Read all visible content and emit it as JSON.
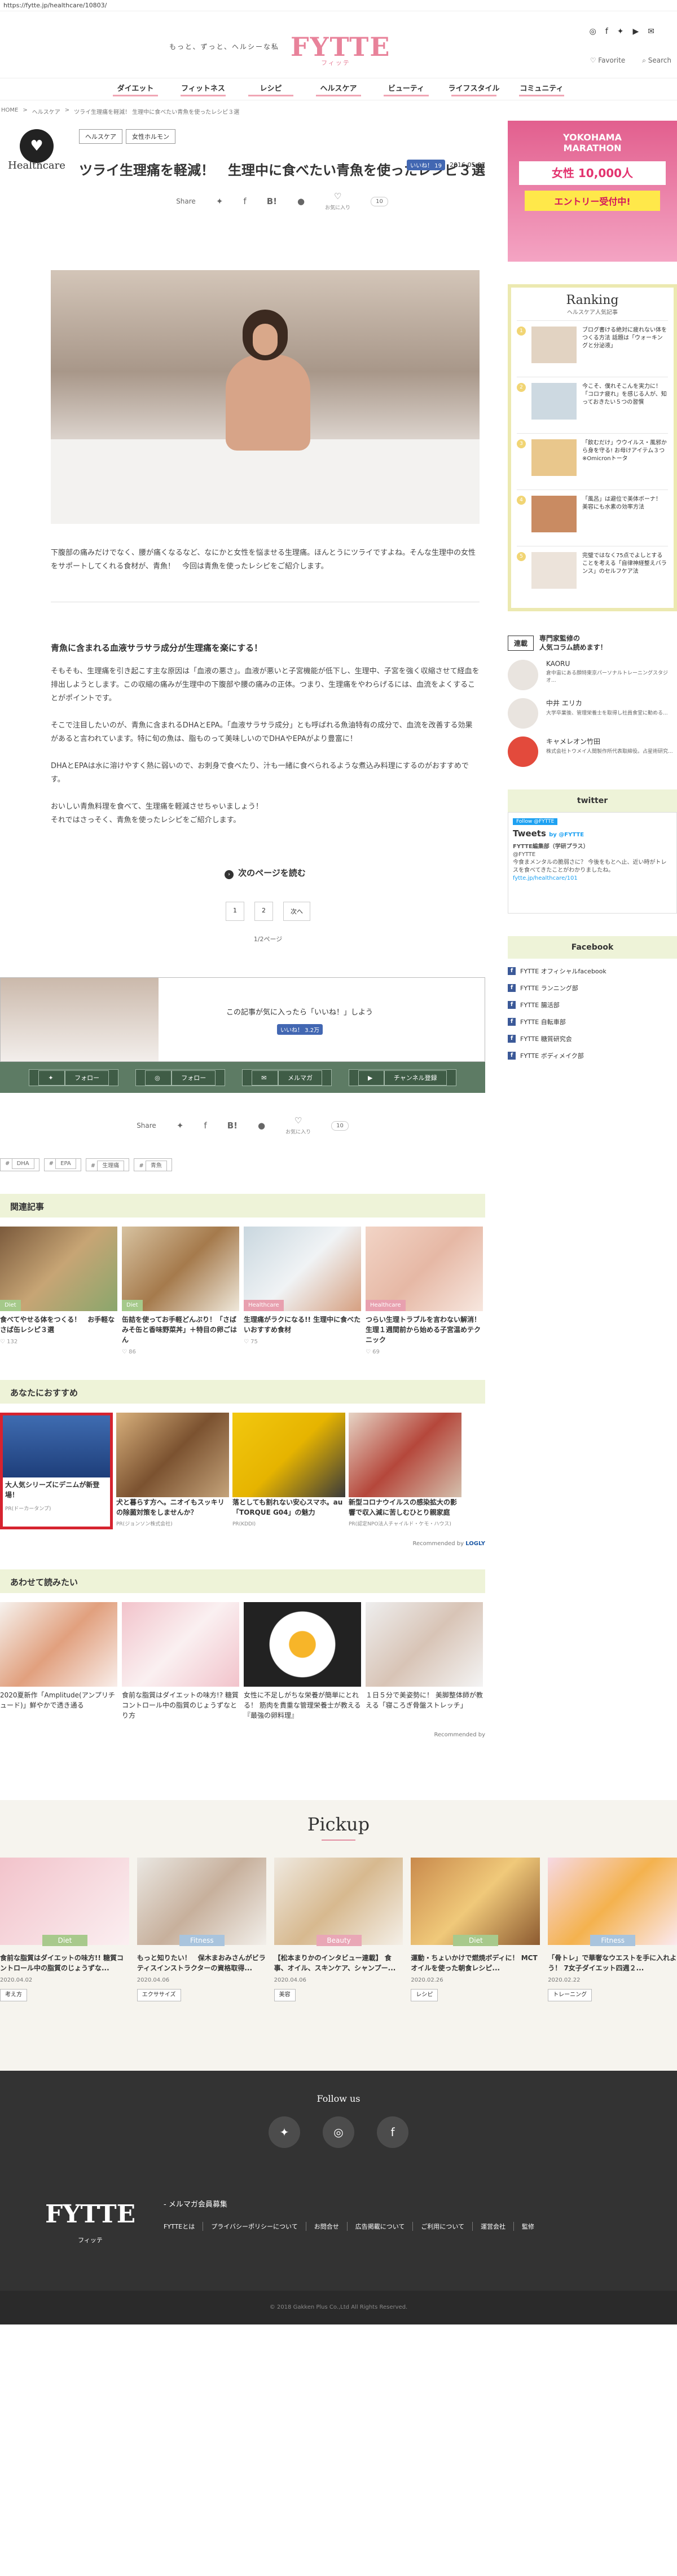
{
  "url": "https://fytte.jp/healthcare/10803/",
  "header": {
    "tagline": "もっと、ずっと、ヘルシーな私",
    "logo": "FYTTE",
    "logo_sub": "フィッテ",
    "favorite": "Favorite",
    "search": "Search"
  },
  "nav": [
    "ダイエット",
    "フィットネス",
    "レシピ",
    "ヘルスケア",
    "ビューティ",
    "ライフスタイル",
    "コミュニティ"
  ],
  "breadcrumb": [
    "HOME",
    "ヘルスケア",
    "ツライ生理痛を軽減！ 生理中に食べたい青魚を使ったレシピ３選"
  ],
  "article": {
    "category_label": "Healthcare",
    "tags": [
      "ヘルスケア",
      "女性ホルモン"
    ],
    "like_label": "いいね！ 19",
    "date": "2016.05.07",
    "title": "ツライ生理痛を軽減！　生理中に食べたい青魚を使ったレシピ３選",
    "share_label": "Share",
    "fav_label": "お気に入り",
    "fav_count": "10",
    "intro": "下腹部の痛みだけでなく、腰が痛くなるなど、なにかと女性を悩ませる生理痛。ほんとうにツライですよね。そんな生理中の女性をサポートしてくれる食材が、青魚！　今回は青魚を使ったレシピをご紹介します。",
    "h2": "青魚に含まれる血液サラサラ成分が生理痛を楽にする！",
    "body1": "そもそも、生理痛を引き起こす主な原因は「血液の悪さ」。血液が悪いと子宮機能が低下し、生理中、子宮を強く収縮させて経血を排出しようとします。この収縮の痛みが生理中の下腹部や腰の痛みの正体。つまり、生理痛をやわらげるには、血流をよくすることがポイントです。",
    "body2": "そこで注目したいのが、青魚に含まれるDHAとEPA。「血液サラサラ成分」とも呼ばれる魚油特有の成分で、血流を改善する効果があると言われています。特に旬の魚は、脂ものって美味しいのでDHAやEPAがより豊富に！",
    "body3": "DHAとEPAは水に溶けやすく熱に弱いので、お刺身で食べたり、汁も一緒に食べられるような煮込み料理にするのがおすすめです。",
    "body4": "おいしい青魚料理を食べて、生理痛を軽減させちゃいましょう！",
    "body5": "それではさっそく、青魚を使ったレシピをご紹介します。",
    "next_label": "次のページを読む",
    "pager": [
      "1",
      "2",
      "次へ"
    ],
    "page_count": "1/2ページ",
    "like_msg": "この記事が気に入ったら「いいね！」しよう",
    "like_btn": "いいね！ 3.2万",
    "follow": [
      "フォロー",
      "フォロー",
      "メルマガ",
      "チャンネル登録"
    ],
    "bottom_tags": [
      "DHA",
      "EPA",
      "生理痛",
      "青魚"
    ]
  },
  "related": {
    "title": "関連記事",
    "items": [
      {
        "cat": "Diet",
        "title": "食べてやせる体をつくる！　お手軽なさば缶レシピ３選",
        "count": "132"
      },
      {
        "cat": "Diet",
        "title": "缶詰を使ってお手軽どんぶり！「さばみそ缶と香味野菜丼」＋特目の卵ごはん",
        "count": "86"
      },
      {
        "cat": "Healthcare",
        "title": "生理痛がラクになる!! 生理中に食べたいおすすめ食材",
        "count": "75"
      },
      {
        "cat": "Healthcare",
        "title": "つらい生理トラブルを言わない解消！生理１週間前から始める子宮温めテクニック",
        "count": "69"
      }
    ]
  },
  "recommend": {
    "title": "あなたにおすすめ",
    "items": [
      {
        "title": "大人気シリーズにデニムが新登場！",
        "src": "PR(ドーカータンプ)"
      },
      {
        "title": "犬と暮らす方へ。ニオイもスッキリの除菌対策をしませんか？",
        "src": "PR(ジョンソン株式会社)"
      },
      {
        "title": "落としても割れない安心スマホ。au「TORQUE G04」の魅力",
        "src": "PR(KDDI)"
      },
      {
        "title": "新型コロナウイルスの感染拡大の影響で収入減に苦しむひとり親家庭",
        "src": "PR(認定NPO法人チャイルド・ケモ・ハウス)"
      }
    ],
    "by": "Recommended by",
    "by_brand": "LOGLY"
  },
  "also": {
    "title": "あわせて読みたい",
    "items": [
      {
        "title": "2020夏新作「Amplitude(アンプリチュード)」鮮やかで透き通る"
      },
      {
        "title": "食前な脂質はダイエットの味方!? 糖質コントロール中の脂質のじょうずなとり方"
      },
      {
        "title": "女性に不足しがちな栄養が簡単にとれる！ 筋肉を貴重な管理栄養士が教える『最強の卵料理』"
      },
      {
        "title": "１日５分で美姿勢に！ 美脚整体師が教える「寝ころぎ骨盤ストレッチ」"
      }
    ],
    "by": "Recommended by"
  },
  "sidebar": {
    "ad": {
      "l1": "YOKOHAMA",
      "l2": "MARATHON",
      "l3": "女性 10,000人",
      "l4": "エントリー受付中!"
    },
    "ranking_title": "Ranking",
    "ranking_sub": "ヘルスケア人気記事",
    "ranking": [
      {
        "n": "1",
        "t": "ブログ書ける絶対に疲れない体をつくる方法 話題は「ウォーキングと分泌液」"
      },
      {
        "n": "2",
        "t": "今こそ、僕れそこんを実力に！ 「コロナ疲れ」を感じる人が、知っておきたい５つの習慣"
      },
      {
        "n": "3",
        "t": "「飲むだけ」ウウイルス・風邪から身を守る! お母けアイテム３つ ※Omicronトータ"
      },
      {
        "n": "4",
        "t": "「風呂」は避位で美体ボーナ！ 美容にも水素の効率方法"
      },
      {
        "n": "5",
        "t": "完璧ではなく75点でよしとすることを考える「自律神経整えバランス」のセルフケア法"
      }
    ],
    "col_box": "連載",
    "col_title": "専門家監修の\n人気コラム読めます！",
    "columnists": [
      {
        "name": "KAORU",
        "desc": "倉中宙にある顔特東京パーソナルトレーニングスタジオ..."
      },
      {
        "name": "中井 エリカ",
        "desc": "大学卒業後、管理栄養士を取得し社員食堂に勤める..."
      },
      {
        "name": "キャメレオン竹田",
        "desc": "株式会社トウメイ人間製作所代表取締役。占星術研究..."
      }
    ],
    "twitter_title": "twitter",
    "tw": {
      "btn": "Follow @FYTTE",
      "head": "Tweets",
      "by": "by @FYTTE",
      "acc": "FYTTE編集部（学研プラス）",
      "handle": "@FYTTE",
      "text": "今食まメンタルの脆弱さに？ 今後をもとへ止、近い時がトレスを食べてきたことがわかりましたね。",
      "link": "fytte.jp/healthcare/101"
    },
    "facebook_title": "Facebook",
    "fb_list": [
      "FYTTE オフィシャルfacebook",
      "FYTTE ランニング部",
      "FYTTE 腸活部",
      "FYTTE 自転車部",
      "FYTTE 糖質研究会",
      "FYTTE ボディメイク部"
    ]
  },
  "pickup": {
    "title": "Pickup",
    "items": [
      {
        "cat": "Diet",
        "color": "#a8c98c",
        "title": "食前な脂質はダイエットの味方!! 糖質コントロール中の脂質のじょうずな...",
        "date": "2020.04.02",
        "tag": "考え方"
      },
      {
        "cat": "Fitness",
        "color": "#a9c4dd",
        "title": "もっと知りたい！　保木まおみさんがビラティスインストラクターの資格取得...",
        "date": "2020.04.06",
        "tag": "エクササイズ"
      },
      {
        "cat": "Beauty",
        "color": "#e9a7b6",
        "title": "【松本まりかのインタビュー連載】 食事、オイル、スキンケア、シャンプー...",
        "date": "2020.04.06",
        "tag": "美容"
      },
      {
        "cat": "Diet",
        "color": "#a8c98c",
        "title": "運動・ちょいかけで燃焼ボディに！ MCTオイルを使った朝食レシピ...",
        "date": "2020.02.26",
        "tag": "レシピ"
      },
      {
        "cat": "Fitness",
        "color": "#a9c4dd",
        "title": "「骨トレ」で華奢なウエストを手に入れよう！ 7女子ダイエット四週２...",
        "date": "2020.02.22",
        "tag": "トレーニング"
      }
    ]
  },
  "footer": {
    "follow": "Follow us",
    "logo": "FYTTE",
    "logo_sub": "フィッテ",
    "mm": "- メルマガ会員募集",
    "links": [
      "FYTTEとは",
      "プライバシーポリシーについて",
      "お問合せ",
      "広告掲載について",
      "ご利用について",
      "運営会社",
      "監修"
    ],
    "copyright": "© 2018 Gakken Plus Co.,Ltd All Rights Reserved."
  }
}
